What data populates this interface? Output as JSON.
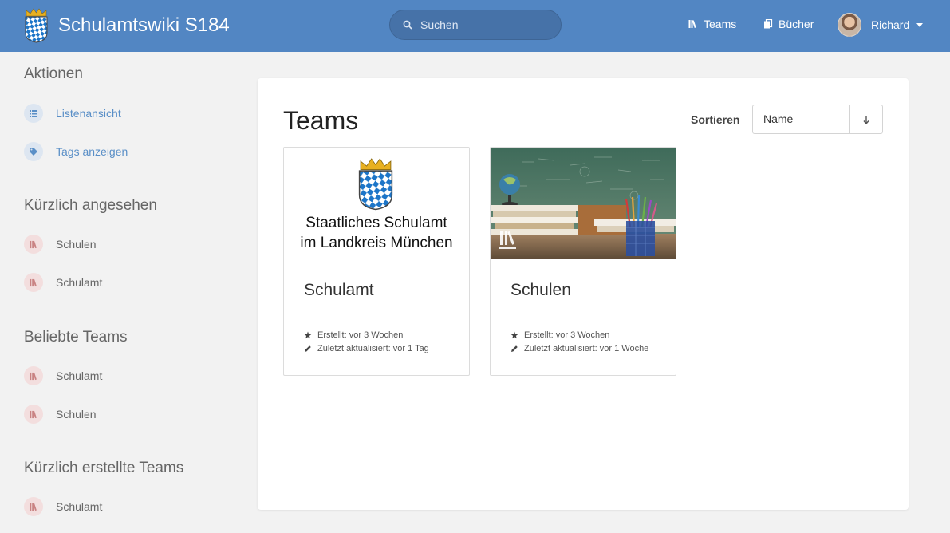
{
  "header": {
    "title": "Schulamtswiki S184",
    "search_placeholder": "Suchen",
    "nav": {
      "teams": "Teams",
      "books": "Bücher"
    },
    "user_name": "Richard"
  },
  "sidebar": {
    "actions_heading": "Aktionen",
    "actions": [
      {
        "label": "Listenansicht",
        "icon": "list-icon"
      },
      {
        "label": "Tags anzeigen",
        "icon": "tag-icon"
      }
    ],
    "recent_heading": "Kürzlich angesehen",
    "recent": [
      {
        "label": "Schulen"
      },
      {
        "label": "Schulamt"
      }
    ],
    "popular_heading": "Beliebte Teams",
    "popular": [
      {
        "label": "Schulamt"
      },
      {
        "label": "Schulen"
      }
    ],
    "created_heading": "Kürzlich erstellte Teams",
    "created": [
      {
        "label": "Schulamt"
      }
    ]
  },
  "main": {
    "title": "Teams",
    "sort_label": "Sortieren",
    "sort_value": "Name",
    "cards": [
      {
        "name": "Schulamt",
        "image_line1": "Staatliches Schulamt",
        "image_line2": "im Landkreis München",
        "created": "Erstellt: vor 3 Wochen",
        "updated": "Zuletzt aktualisiert: vor 1 Tag"
      },
      {
        "name": "Schulen",
        "created": "Erstellt: vor 3 Wochen",
        "updated": "Zuletzt aktualisiert: vor 1 Woche"
      }
    ]
  },
  "colors": {
    "header": "#5286c3",
    "link": "#5a8fc7",
    "entity_bubble": "#f3dede"
  }
}
